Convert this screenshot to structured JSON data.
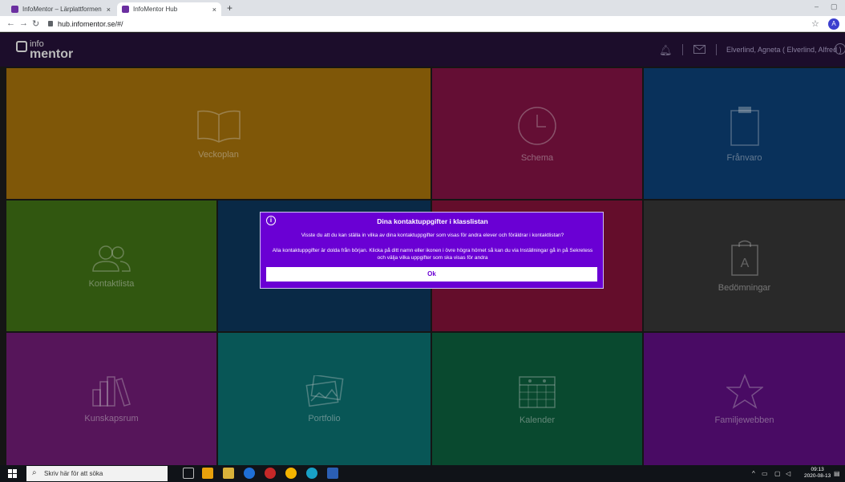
{
  "browser": {
    "tabs": [
      {
        "title": "InfoMentor – Lärplattformen m…",
        "close": "×"
      },
      {
        "title": "InfoMentor Hub",
        "close": "×"
      }
    ],
    "new_tab": "+",
    "minimize": "–",
    "restore": "▢",
    "url": "hub.infomentor.se/#/",
    "profile_initial": "A"
  },
  "app": {
    "logo_top": "info",
    "logo_bottom": "mentor",
    "user_name": "Elverlind, Agneta ( Elverlind, Alfred )",
    "accent": "#6a00d4"
  },
  "tiles": [
    {
      "label": "Veckoplan",
      "icon": "book-icon",
      "color": "#9c6b0a"
    },
    {
      "label": "Schema",
      "icon": "clock-icon",
      "color": "#7a1240"
    },
    {
      "label": "Frånvaro",
      "icon": "clipboard-icon",
      "color": "#0c3c70"
    },
    {
      "label": "Kontaktlista",
      "icon": "people-icon",
      "color": "#3c6b14"
    },
    {
      "label": "",
      "icon": "",
      "color": "#0c3256"
    },
    {
      "label": "",
      "icon": "",
      "color": "#7a1035"
    },
    {
      "label": "Bedömningar",
      "icon": "grade-clipboard-icon",
      "color": "#333333",
      "icon_letter": "A"
    },
    {
      "label": "Kunskapsrum",
      "icon": "books-icon",
      "color": "#6a1a6e"
    },
    {
      "label": "Portfolio",
      "icon": "pictures-icon",
      "color": "#0a6a6a"
    },
    {
      "label": "Kalender",
      "icon": "calendar-icon",
      "color": "#0c5a3a"
    },
    {
      "label": "Familjewebben",
      "icon": "star-icon",
      "color": "#5a0e7a"
    }
  ],
  "modal": {
    "title": "Dina kontaktuppgifter i klasslistan",
    "paragraph1": "Visste du att du kan ställa in vilka av dina kontaktuppgifter som visas för andra elever och föräldrar i kontaktlistan?",
    "paragraph2": "Alla kontaktuppgifter är dolda från början. Klicka på ditt namn eller ikonen i övre högra hörnet så kan du via Inställningar gå in på Sekretess och välja vilka uppgifter som ska visas för andra",
    "ok_label": "Ok"
  },
  "taskbar": {
    "search_placeholder": "Skriv här för att söka",
    "time": "09:13",
    "date": "2020-08-13"
  }
}
